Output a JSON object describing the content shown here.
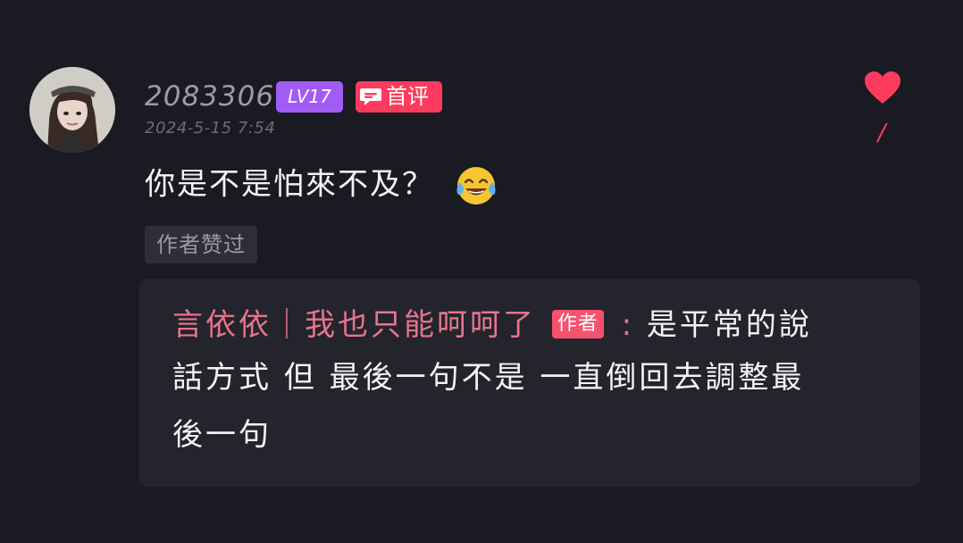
{
  "comment": {
    "username": "2083306",
    "level_badge": "LV17",
    "first_comment_badge": "首评",
    "timestamp": "2024-5-15 7:54",
    "text": "你是不是怕來不及？",
    "emoji": "face-with-tears-of-joy",
    "author_liked_tag": "作者赞过",
    "like_count": "/"
  },
  "reply": {
    "author": "言依依｜我也只能呵呵了",
    "author_tag": "作者",
    "colon": ":",
    "line1": "是平常的說",
    "line2": "話方式 但 最後一句不是 一直倒回去調整最",
    "line3": "後一句"
  },
  "colors": {
    "background": "#1a1a22",
    "level_badge": "#a35bf5",
    "first_badge": "#fe3a5e",
    "like_heart": "#fe3a5e",
    "reply_author": "#e6758d",
    "reply_box": "#24242c"
  }
}
